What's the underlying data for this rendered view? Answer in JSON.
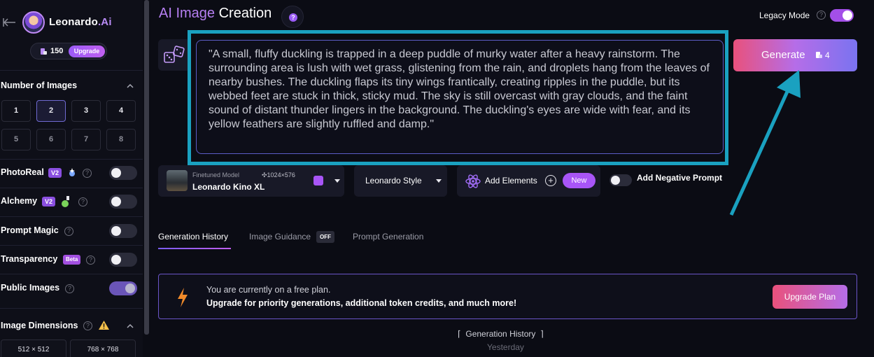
{
  "app": {
    "logo_text": "Leonardo",
    "logo_suffix": ".Ai"
  },
  "tokens": {
    "count": "150",
    "upgrade_label": "Upgrade"
  },
  "sidebar": {
    "number_of_images": {
      "title": "Number of Images",
      "options": [
        "1",
        "2",
        "3",
        "4",
        "5",
        "6",
        "7",
        "8"
      ],
      "selected": "2"
    },
    "toggles": [
      {
        "label": "PhotoReal",
        "badge": "V2",
        "on": false
      },
      {
        "label": "Alchemy",
        "badge": "V2",
        "on": false
      },
      {
        "label": "Prompt Magic",
        "on": false
      },
      {
        "label": "Transparency",
        "badge": "Beta",
        "on": false
      },
      {
        "label": "Public Images",
        "on": true
      }
    ],
    "image_dimensions": {
      "title": "Image Dimensions",
      "options": [
        "512 × 512",
        "768 × 768"
      ]
    }
  },
  "header": {
    "title_prefix": "AI Image",
    "title_suffix": "Creation",
    "help_glyph": "?",
    "legacy_mode_label": "Legacy Mode",
    "legacy_mode_on": true
  },
  "prompt": {
    "text": "\"A small, fluffy duckling is trapped in a deep puddle of murky water after a heavy rainstorm. The surrounding area is lush with wet grass, glistening from the rain, and droplets hang from the leaves of nearby bushes. The duckling flaps its tiny wings frantically, creating ripples in the puddle, but its webbed feet are stuck in thick, sticky mud. The sky is still overcast with gray clouds, and the faint sound of distant thunder lingers in the background. The duckling's eyes are wide with fear, and its yellow feathers are slightly ruffled and damp.\""
  },
  "generate": {
    "label": "Generate",
    "cost": "4"
  },
  "model": {
    "subtitle": "Finetuned Model",
    "name": "Leonardo Kino XL",
    "dimensions": "1024×576"
  },
  "style": {
    "label": "Leonardo Style"
  },
  "elements": {
    "label": "Add Elements",
    "new_badge": "New"
  },
  "negative_prompt": {
    "label": "Add Negative Prompt",
    "on": false
  },
  "tabs": [
    {
      "label": "Generation History",
      "active": true
    },
    {
      "label": "Image Guidance",
      "badge": "OFF"
    },
    {
      "label": "Prompt Generation"
    }
  ],
  "banner": {
    "line1": "You are currently on a free plan.",
    "line2": "Upgrade for priority generations, additional token credits, and much more!",
    "button_label": "Upgrade Plan"
  },
  "history": {
    "title": "Generation History",
    "date_label": "Yesterday"
  },
  "colors": {
    "accent": "#a855f7",
    "highlight": "#1aa1c0",
    "generate_start": "#e9517c",
    "generate_end": "#7a73f0"
  }
}
